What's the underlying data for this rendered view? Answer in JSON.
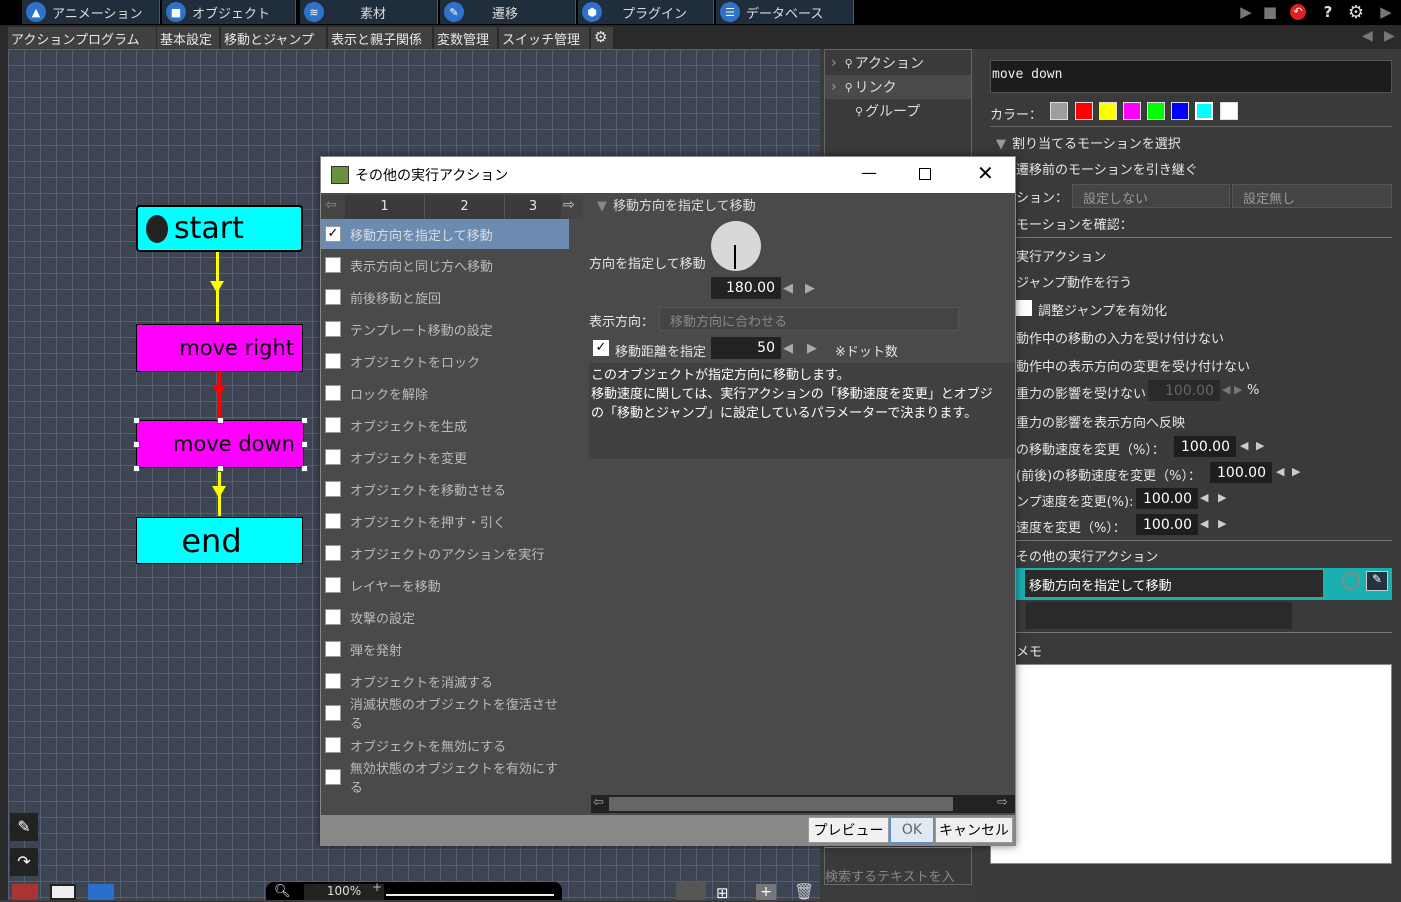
{
  "topbar": {
    "tabs": [
      {
        "label": "アニメーション",
        "icon": "animation-icon"
      },
      {
        "label": "オブジェクト",
        "icon": "object-icon"
      },
      {
        "label": "素材",
        "icon": "material-icon"
      },
      {
        "label": "遷移",
        "icon": "transition-icon"
      },
      {
        "label": "プラグイン",
        "icon": "plugin-icon"
      },
      {
        "label": "データベース",
        "icon": "database-icon"
      }
    ]
  },
  "subtabs": [
    "アクションプログラム",
    "基本設定",
    "移動とジャンプ",
    "表示と親子関係",
    "変数管理",
    "スイッチ管理"
  ],
  "canvas": {
    "nodes": {
      "start": "start",
      "move_right": "move right",
      "move_down": "move down",
      "end": "end"
    },
    "zoom": "100%"
  },
  "linkpanel": {
    "items": [
      "アクション",
      "リンク",
      "グループ"
    ],
    "search_placeholder": "検索するテキストを入"
  },
  "props": {
    "name": "move down",
    "color_label": "カラー：",
    "colors": [
      "#9e9e9e",
      "#ff0000",
      "#ffff00",
      "#ff00ff",
      "#00ff00",
      "#0000ff",
      "#00ffff",
      "#ffffff"
    ],
    "motion_section": "割り当てるモーションを選択",
    "inherit_motion": "遷移前のモーションを引き継ぐ",
    "motion_label": "ション：",
    "motion_value1": "設定しない",
    "motion_value2": "設定無し",
    "confirm_motion": "モーションを確認：",
    "exec_action": "実行アクション",
    "jump": "ジャンプ動作を行う",
    "adjust_jump": "調整ジャンプを有効化",
    "no_move_input": "動作中の移動の入力を受け付けない",
    "no_dir_change": "動作中の表示方向の変更を受け付けない",
    "no_gravity": "重力の影響を受けない",
    "gravity_value": "100.00",
    "gravity_unit": "%",
    "gravity_dir": "重力の影響を表示方向へ反映",
    "speed1_label": "の移動速度を変更（%）：",
    "speed1_value": "100.00",
    "speed2_label": "(前後)の移動速度を変更（%）：",
    "speed2_value": "100.00",
    "speed3_label": "ンプ速度を変更(%):",
    "speed3_value": "100.00",
    "speed4_label": "速度を変更（%）：",
    "speed4_value": "100.00",
    "other_actions": "その他の実行アクション",
    "other_action_item": "移動方向を指定して移動",
    "memo": "メモ"
  },
  "dialog": {
    "title": "その他の実行アクション",
    "pages": [
      "1",
      "2",
      "3"
    ],
    "actions": [
      {
        "label": "移動方向を指定して移動",
        "checked": true
      },
      {
        "label": "表示方向と同じ方へ移動",
        "checked": false
      },
      {
        "label": "前後移動と旋回",
        "checked": false
      },
      {
        "label": "テンプレート移動の設定",
        "checked": false
      },
      {
        "label": "オブジェクトをロック",
        "checked": false
      },
      {
        "label": "ロックを解除",
        "checked": false
      },
      {
        "label": "オブジェクトを生成",
        "checked": false
      },
      {
        "label": "オブジェクトを変更",
        "checked": false
      },
      {
        "label": "オブジェクトを移動させる",
        "checked": false
      },
      {
        "label": "オブジェクトを押す・引く",
        "checked": false
      },
      {
        "label": "オブジェクトのアクションを実行",
        "checked": false
      },
      {
        "label": "レイヤーを移動",
        "checked": false
      },
      {
        "label": "攻撃の設定",
        "checked": false
      },
      {
        "label": "弾を発射",
        "checked": false
      },
      {
        "label": "オブジェクトを消滅する",
        "checked": false
      },
      {
        "label": "消滅状態のオブジェクトを復活させる",
        "checked": false
      },
      {
        "label": "オブジェクトを無効にする",
        "checked": false
      },
      {
        "label": "無効状態のオブジェクトを有効にする",
        "checked": false
      }
    ],
    "section_title": "移動方向を指定して移動",
    "direction_label": "方向を指定して移動",
    "direction_value": "180.00",
    "display_dir_label": "表示方向：",
    "display_dir_value": "移動方向に合わせる",
    "distance_label": "移動距離を指定",
    "distance_value": "50",
    "distance_unit": "※ドット数",
    "description_line1": "このオブジェクトが指定方向に移動します。",
    "description_line2": "移動速度に関しては、実行アクションの「移動速度を変更」とオブジ",
    "description_line3": "の「移動とジャンプ」に設定しているパラメーターで決まります。",
    "preview_button": "プレビュー",
    "ok_button": "OK",
    "cancel_button": "キャンセル"
  }
}
